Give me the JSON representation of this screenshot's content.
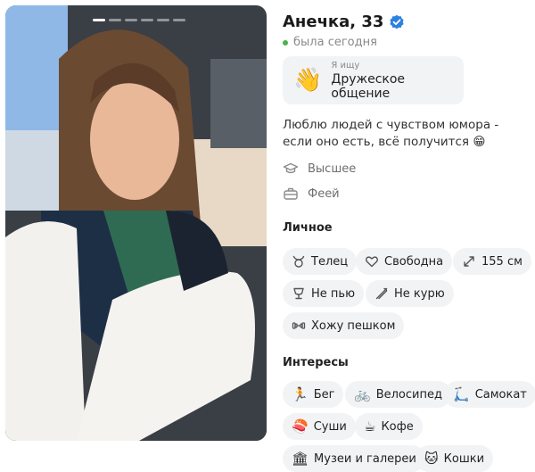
{
  "profile": {
    "name": "Анечка, 33",
    "status": "была сегодня",
    "seeking_label": "Я ищу",
    "seeking_value": "Дружеское общение",
    "bio": "Люблю людей с чувством юмора - если оно есть, всё получится 😁",
    "education": "Высшее",
    "job": "Феей"
  },
  "photo": {
    "pages": 6,
    "active_index": 0
  },
  "colors": {
    "verified": "#2d81e0",
    "online": "#4bb34b",
    "chip_bg": "#f2f3f5"
  },
  "personal": {
    "title": "Личное",
    "chips": [
      {
        "icon": "taurus-icon",
        "label": "Телец"
      },
      {
        "icon": "heart-icon",
        "label": "Свободна"
      },
      {
        "icon": "height-icon",
        "label": "155 см"
      },
      {
        "icon": "no-drink-icon",
        "label": "Не пью"
      },
      {
        "icon": "no-smoke-icon",
        "label": "Не курю"
      },
      {
        "icon": "dumbbell-icon",
        "label": "Хожу пешком"
      }
    ]
  },
  "interests": {
    "title": "Интересы",
    "chips": [
      {
        "icon": "runner-icon",
        "emoji": "🏃",
        "label": "Бег"
      },
      {
        "icon": "bicycle-icon",
        "emoji": "🚲",
        "label": "Велосипед"
      },
      {
        "icon": "scooter-icon",
        "emoji": "🛴",
        "label": "Самокат"
      },
      {
        "icon": "sushi-icon",
        "emoji": "🍣",
        "label": "Суши"
      },
      {
        "icon": "coffee-icon",
        "emoji": "☕",
        "label": "Кофе"
      },
      {
        "icon": "museum-icon",
        "emoji": "🏛",
        "label": "Музеи и галереи"
      },
      {
        "icon": "cat-icon",
        "emoji": "🐱",
        "label": "Кошки"
      }
    ]
  }
}
